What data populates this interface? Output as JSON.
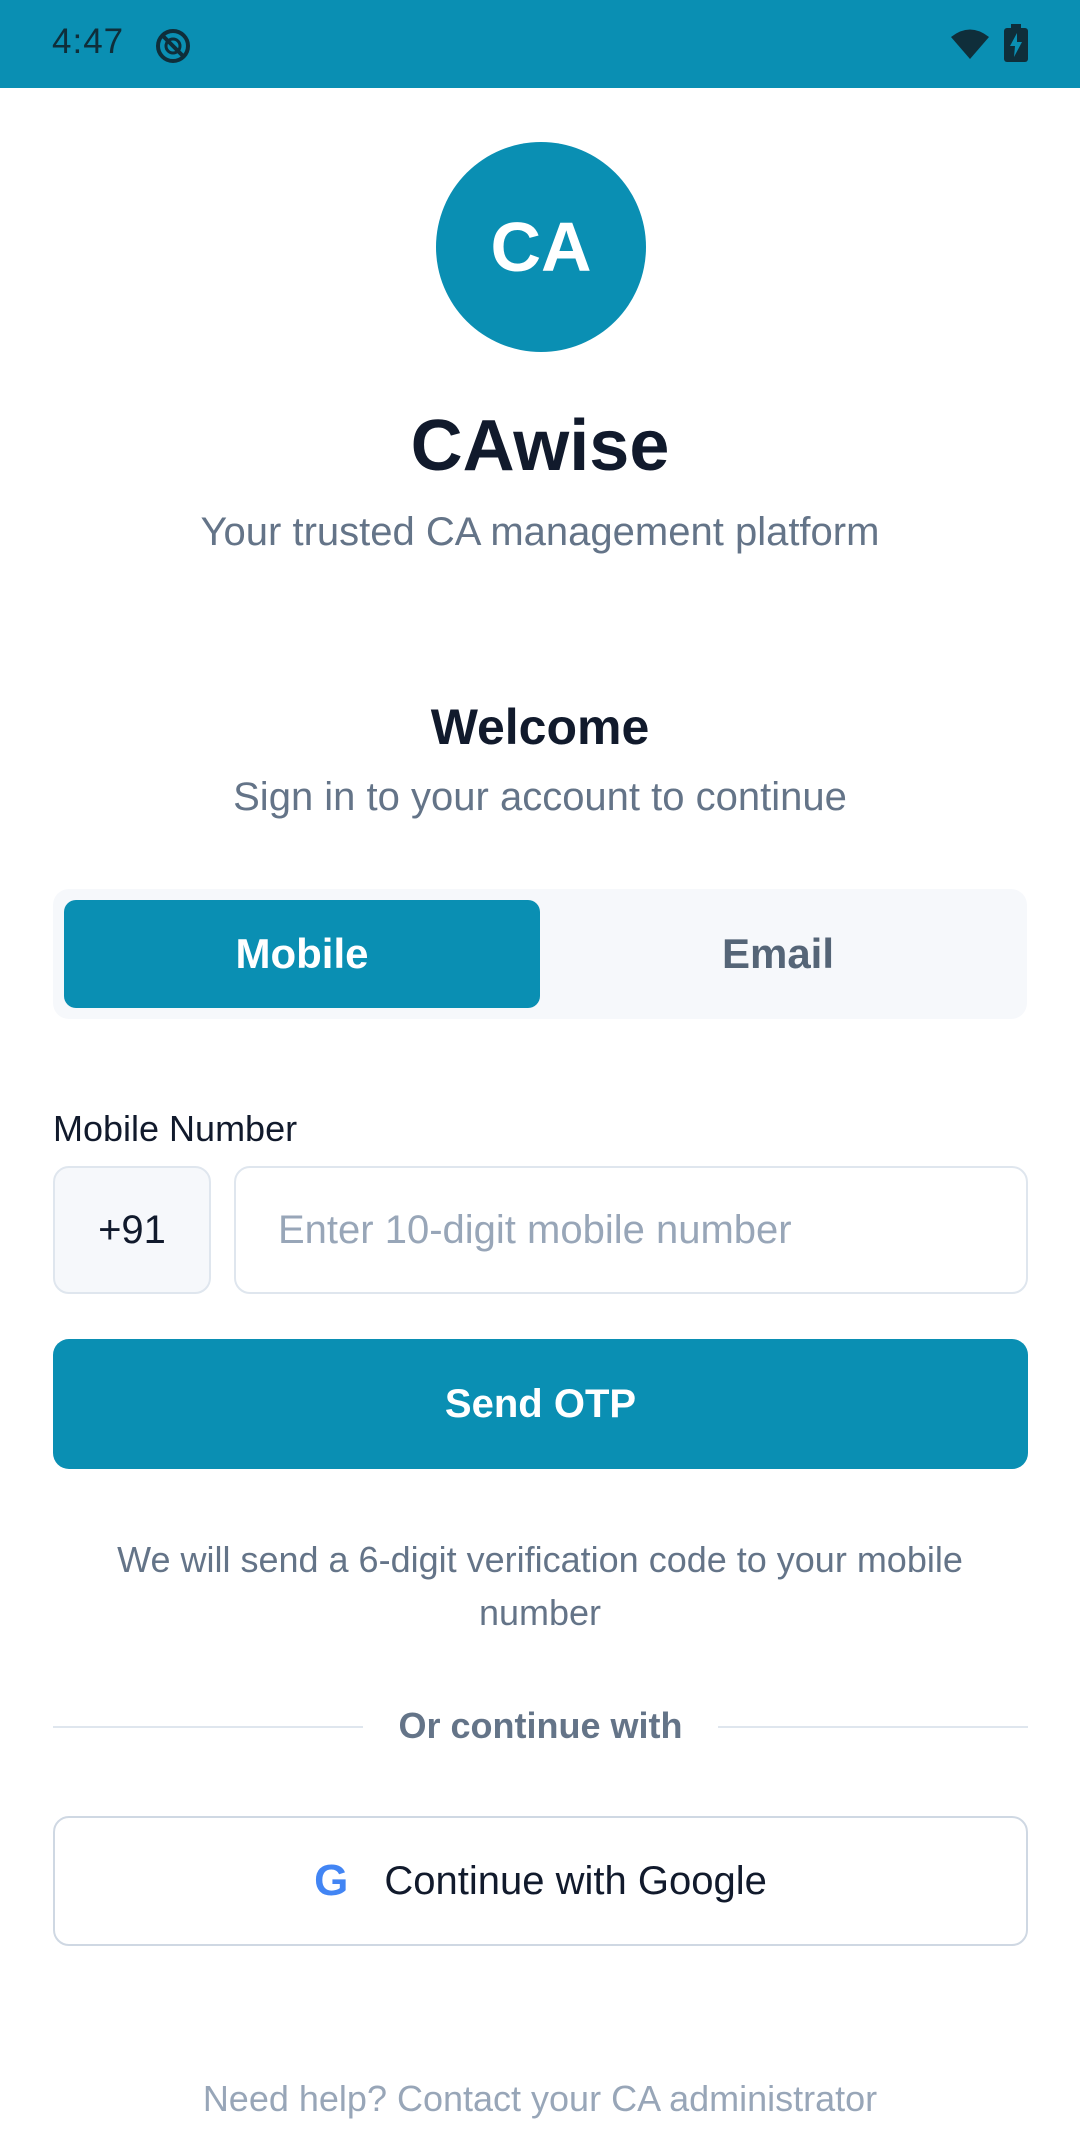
{
  "status_bar": {
    "time": "4:47",
    "icons": [
      "do-not-disturb-icon",
      "wifi-icon",
      "battery-charging-icon"
    ]
  },
  "brand": {
    "logo_text": "CA",
    "app_name": "CAwise",
    "tagline": "Your trusted CA management platform",
    "accent_color": "#0a8fb3"
  },
  "welcome": {
    "title": "Welcome",
    "subtitle": "Sign in to your account to continue"
  },
  "tabs": [
    {
      "label": "Mobile",
      "active": true
    },
    {
      "label": "Email",
      "active": false
    }
  ],
  "mobile_field": {
    "label": "Mobile Number",
    "country_code": "+91",
    "placeholder": "Enter 10-digit mobile number",
    "value": ""
  },
  "send_otp": {
    "label": "Send OTP",
    "note": "We will send a 6-digit verification code to your mobile number"
  },
  "divider": {
    "label": "Or continue with"
  },
  "google": {
    "icon_letter": "G",
    "label": "Continue with Google"
  },
  "help": {
    "text": "Need help? Contact your CA administrator"
  }
}
